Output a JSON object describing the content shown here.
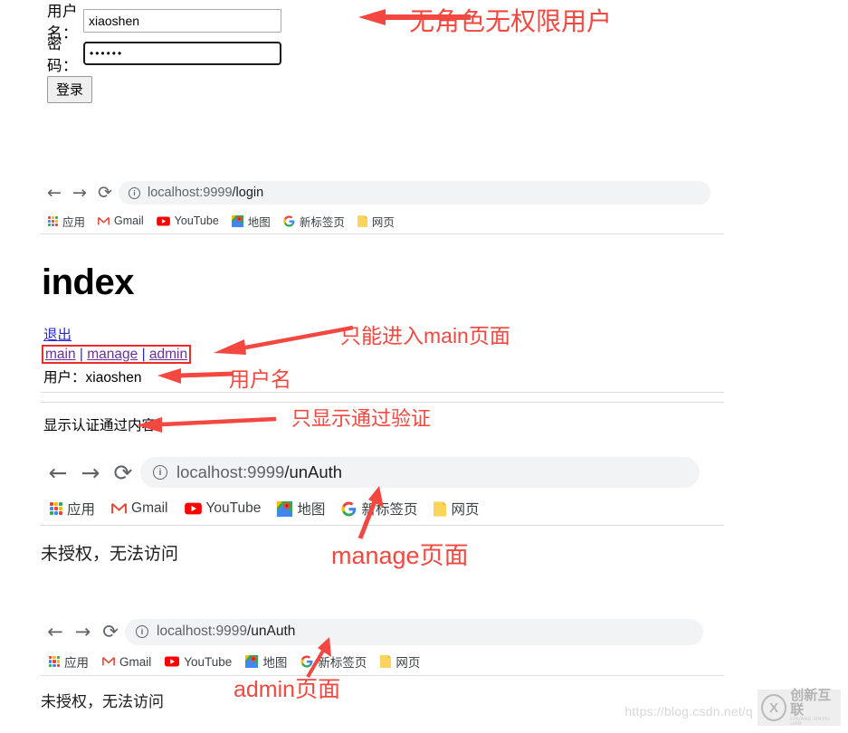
{
  "login_form": {
    "username_label": "用户名：",
    "username_value": "xiaoshen",
    "password_label": "密码：",
    "password_value": "••••••",
    "submit_label": "登录"
  },
  "annotations": {
    "no_role_user": "无角色无权限用户",
    "only_main_page": "只能进入main页面",
    "username": "用户名",
    "only_show_authenticated": "只显示通过验证",
    "manage_page": "manage页面",
    "admin_page": "admin页面"
  },
  "browsers": [
    {
      "id": "login",
      "back_icon": "←",
      "forward_icon": "→",
      "reload_icon": "⟳",
      "info_icon": "i",
      "url_host": "localhost:9999",
      "url_path": "/login",
      "bookmarks": [
        {
          "icon": "apps-grid-icon",
          "label": "应用"
        },
        {
          "icon": "gmail-icon",
          "label": "Gmail"
        },
        {
          "icon": "youtube-icon",
          "label": "YouTube"
        },
        {
          "icon": "maps-icon",
          "label": "地图"
        },
        {
          "icon": "google-icon",
          "label": "新标签页"
        },
        {
          "icon": "folder-icon",
          "label": "网页"
        }
      ]
    },
    {
      "id": "unauth-manage",
      "back_icon": "←",
      "forward_icon": "→",
      "reload_icon": "⟳",
      "info_icon": "i",
      "url_host": "localhost:9999",
      "url_path": "/unAuth",
      "body_text": "未授权，无法访问",
      "bookmarks": [
        {
          "icon": "apps-grid-icon",
          "label": "应用"
        },
        {
          "icon": "gmail-icon",
          "label": "Gmail"
        },
        {
          "icon": "youtube-icon",
          "label": "YouTube"
        },
        {
          "icon": "maps-icon",
          "label": "地图"
        },
        {
          "icon": "google-icon",
          "label": "新标签页"
        },
        {
          "icon": "folder-icon",
          "label": "网页"
        }
      ]
    },
    {
      "id": "unauth-admin",
      "back_icon": "←",
      "forward_icon": "→",
      "reload_icon": "⟳",
      "info_icon": "i",
      "url_host": "localhost:9999",
      "url_path": "/unAuth",
      "body_text": "未授权，无法访问",
      "bookmarks": [
        {
          "icon": "apps-grid-icon",
          "label": "应用"
        },
        {
          "icon": "gmail-icon",
          "label": "Gmail"
        },
        {
          "icon": "youtube-icon",
          "label": "YouTube"
        },
        {
          "icon": "maps-icon",
          "label": "地图"
        },
        {
          "icon": "google-icon",
          "label": "新标签页"
        },
        {
          "icon": "folder-icon",
          "label": "网页"
        }
      ]
    }
  ],
  "index_page": {
    "title": "index",
    "logout_link": "退出",
    "nav": {
      "main": "main",
      "sep1": " | ",
      "manage": "manage",
      "sep2": " | ",
      "admin": "admin"
    },
    "user_line": "用户：xiaoshen",
    "auth_content": "显示认证通过内容"
  },
  "watermark": {
    "url": "https://blog.csdn.net/q",
    "brand_cn": "创新互联",
    "brand_py": "CHUANG XIN HU LIAN",
    "mark": "X"
  },
  "colors": {
    "annotation_red": "#f4473f",
    "link_blue": "#2b2bd0",
    "link_visited": "#6b2fa0",
    "omnibox_bg": "#f1f3f4",
    "separator": "#dadce0"
  }
}
